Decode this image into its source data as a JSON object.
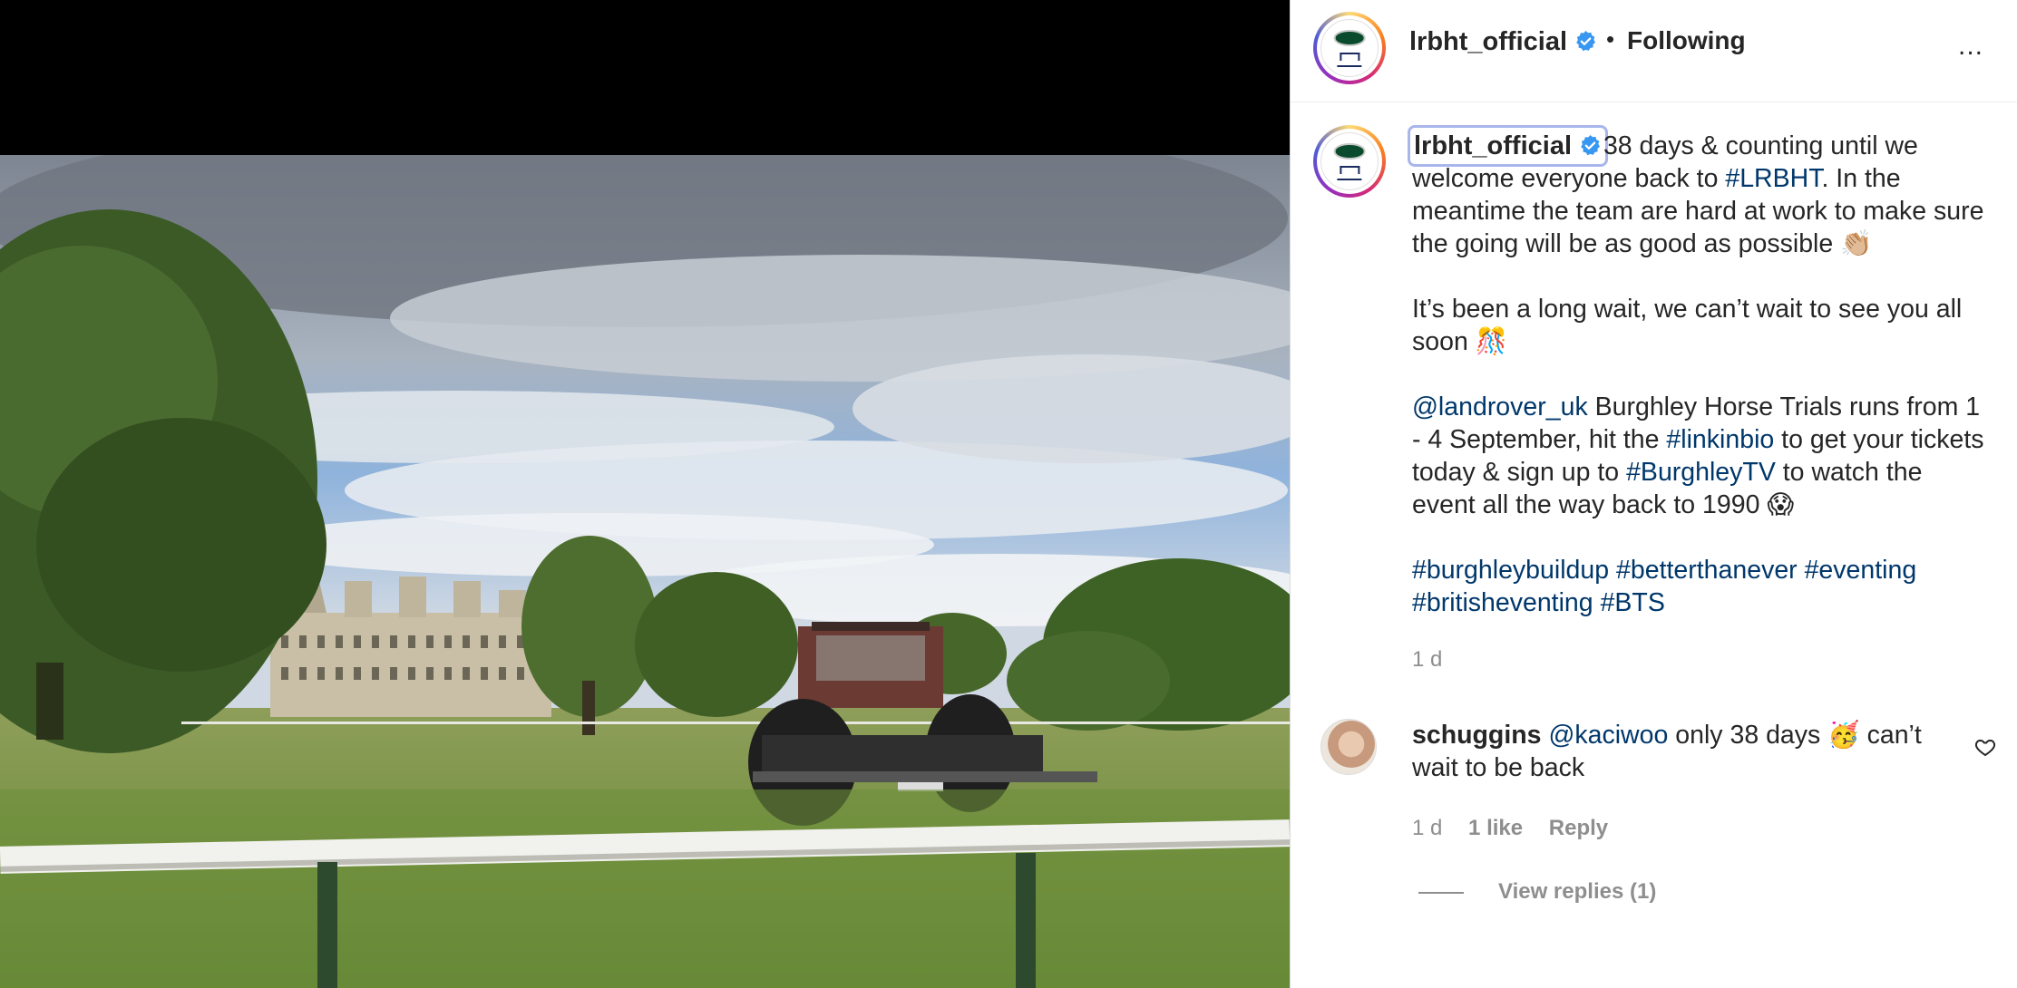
{
  "post": {
    "username": "lrbht_official",
    "separator": "•",
    "follow_status": "Following",
    "more_options": "..."
  },
  "caption": {
    "username": "lrbht_official",
    "p1_text": "38 days & counting until we welcome everyone back to ",
    "p1_tag": "#LRBHT",
    "p1_rest": ". In the meantime the team are hard at work to make sure the going will be as good as possible 👏🏼",
    "p2_text": "It’s been a long wait, we can’t wait to see you all soon 🎊",
    "p3_mention": "@landrover_uk",
    "p3_text1": " Burghley Horse Trials runs from 1 - 4 September, hit the ",
    "p3_tag1": "#linkinbio",
    "p3_text2": " to get your tickets today & sign up to ",
    "p3_tag2": "#BurghleyTV",
    "p3_text3": " to watch the event all the way back to 1990 😱",
    "hashtags": [
      "#burghleybuildup",
      "#betterthanever",
      "#eventing",
      "#britisheventing",
      "#BTS"
    ],
    "time": "1 d"
  },
  "comment": {
    "username": "schuggins",
    "mention": "@kaciwoo",
    "text": " only 38 days 🥳 can’t wait to be back",
    "time": "1 d",
    "likes": "1 like",
    "reply": "Reply",
    "view_replies": "View replies (1)"
  },
  "colors": {
    "link": "#00376b",
    "verified": "#3897f0",
    "meta": "#8e8e8e"
  },
  "icons": [
    "verified-badge-icon",
    "more-options-icon",
    "heart-icon"
  ]
}
